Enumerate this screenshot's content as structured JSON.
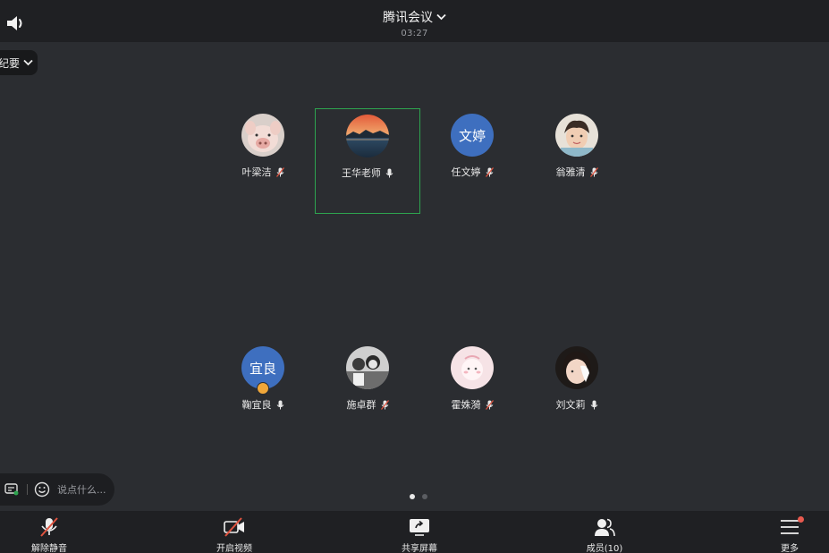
{
  "header": {
    "title": "腾讯会议",
    "timer": "03:27"
  },
  "summary_button": {
    "label": "纪要"
  },
  "participants": [
    {
      "name": "叶梁洁",
      "avatar": "pig-photo",
      "mic": "muted",
      "active": false
    },
    {
      "name": "王华老师",
      "avatar": "sunset-photo",
      "mic": "on",
      "active": true
    },
    {
      "name": "任文婷",
      "avatar_text": "文婷",
      "mic": "muted",
      "active": false
    },
    {
      "name": "翁雅清",
      "avatar": "girl-photo",
      "mic": "muted",
      "active": false
    },
    {
      "name": "鞠宜良",
      "avatar_text": "宜良",
      "mic": "on",
      "active": false,
      "host": true
    },
    {
      "name": "施卓群",
      "avatar": "group-photo",
      "mic": "muted",
      "active": false
    },
    {
      "name": "霍姝漪",
      "avatar": "pink-cartoon",
      "mic": "muted",
      "active": false
    },
    {
      "name": "刘文莉",
      "avatar": "child-photo",
      "mic": "on",
      "active": false
    }
  ],
  "pagination": {
    "current": 1,
    "total": 2
  },
  "chat": {
    "placeholder": "说点什么..."
  },
  "toolbar": {
    "unmute": "解除静音",
    "start_video": "开启视频",
    "share_screen": "共享屏幕",
    "members": "成员(10)",
    "more": "更多"
  },
  "colors": {
    "background": "#2b2d31",
    "bar": "#1f2023",
    "active_border": "#2ea44f",
    "avatar_blue": "#3e6fbf",
    "muted_red": "#e0533f",
    "notify": "#e85a4f"
  }
}
